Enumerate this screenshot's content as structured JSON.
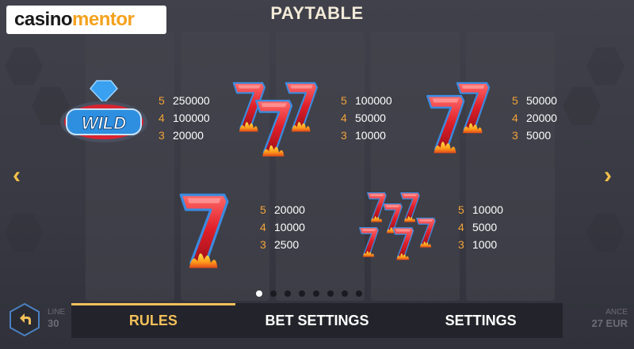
{
  "app": {
    "logo_part1": "casino",
    "logo_part2": "mentor",
    "title": "PAYTABLE"
  },
  "symbols": [
    {
      "name": "wild",
      "label": "WILD",
      "pays": [
        {
          "count": "5",
          "value": "250000"
        },
        {
          "count": "4",
          "value": "100000"
        },
        {
          "count": "3",
          "value": "20000"
        }
      ]
    },
    {
      "name": "triple-burning-seven",
      "pays": [
        {
          "count": "5",
          "value": "100000"
        },
        {
          "count": "4",
          "value": "50000"
        },
        {
          "count": "3",
          "value": "10000"
        }
      ]
    },
    {
      "name": "double-burning-seven",
      "pays": [
        {
          "count": "5",
          "value": "50000"
        },
        {
          "count": "4",
          "value": "20000"
        },
        {
          "count": "3",
          "value": "5000"
        }
      ]
    },
    {
      "name": "single-burning-seven",
      "pays": [
        {
          "count": "5",
          "value": "20000"
        },
        {
          "count": "4",
          "value": "10000"
        },
        {
          "count": "3",
          "value": "2500"
        }
      ]
    },
    {
      "name": "mini-sevens-cluster",
      "pays": [
        {
          "count": "5",
          "value": "10000"
        },
        {
          "count": "4",
          "value": "5000"
        },
        {
          "count": "3",
          "value": "1000"
        }
      ]
    }
  ],
  "pagination": {
    "total_pages": 8,
    "active_page": 1
  },
  "tabs": [
    {
      "label": "RULES",
      "active": true
    },
    {
      "label": "BET SETTINGS",
      "active": false
    },
    {
      "label": "SETTINGS",
      "active": false
    }
  ],
  "footer": {
    "left_partial_1": "LINE",
    "left_partial_2": "30",
    "right_partial_1": "ANCE",
    "right_partial_2": "27 EUR"
  },
  "colors": {
    "accent": "#f2c05a",
    "count": "#f2a33a",
    "background": "#3b3c45",
    "tab_bar": "#23232b"
  },
  "icons": {
    "prev": "chevron-left-icon",
    "next": "chevron-right-icon",
    "back": "back-arrow-icon"
  }
}
